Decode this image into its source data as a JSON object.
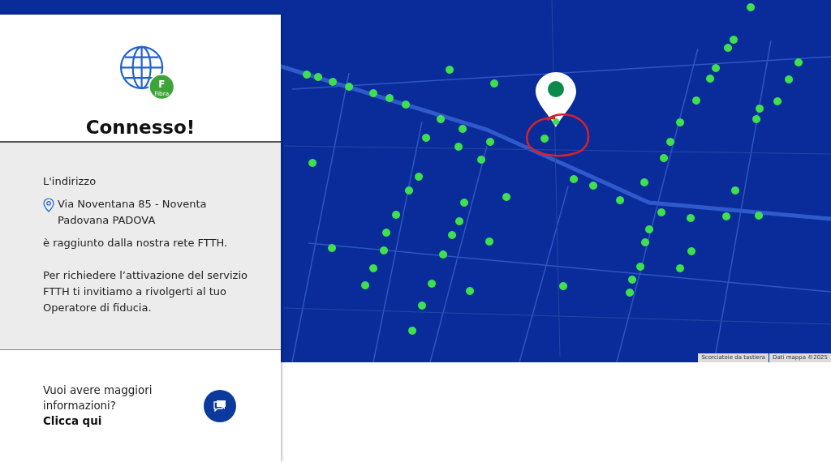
{
  "status": {
    "title": "Connesso!",
    "badge_letter": "F",
    "badge_label": "Fibra"
  },
  "details": {
    "intro": "L'indirizzo",
    "address": "Via Noventana 85 - Noventa Padovana PADOVA",
    "reach": "è raggiunto dalla nostra rete FTTH.",
    "advice": "Per richiedere l’attivazione del servizio FTTH ti invitiamo a rivolgerti al tuo Operatore di fiducia."
  },
  "contact": {
    "question": "Vuoi avere maggiori informazioni?",
    "link": "Clicca qui"
  },
  "map": {
    "attribution": [
      "Scorciatoie da tastiera",
      "Dati mappa ©2025"
    ]
  }
}
